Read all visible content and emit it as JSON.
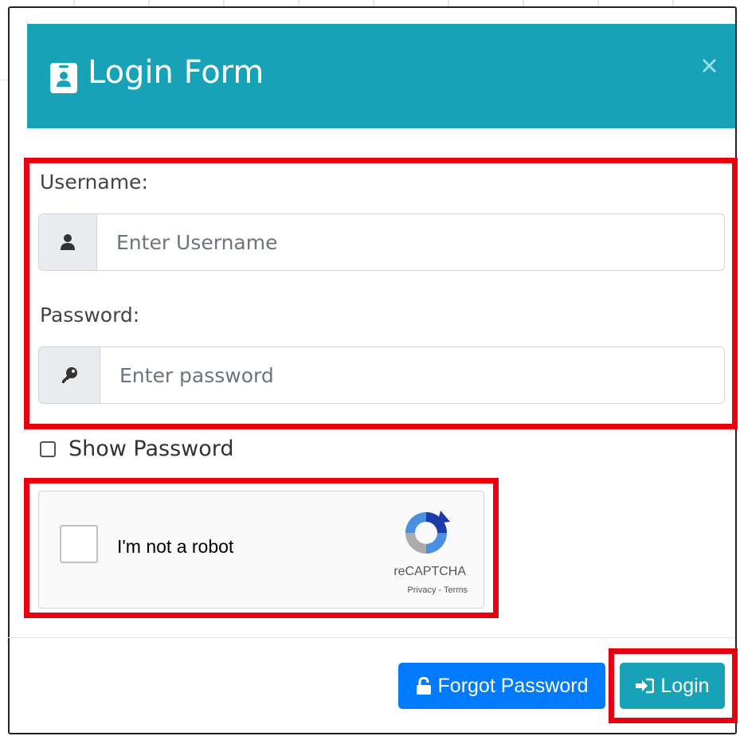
{
  "modal": {
    "title": "Login Form",
    "close_label": "×"
  },
  "form": {
    "username_label": "Username:",
    "username_placeholder": "Enter Username",
    "password_label": "Password:",
    "password_placeholder": "Enter password",
    "show_password_label": "Show Password"
  },
  "captcha": {
    "label": "I'm not a robot",
    "brand": "reCAPTCHA",
    "links": "Privacy - Terms"
  },
  "footer": {
    "forgot_label": "Forgot Password",
    "login_label": "Login"
  },
  "colors": {
    "header": "#18a2b8",
    "primary": "#007bff",
    "info": "#17a2b8",
    "highlight": "#e8000e"
  },
  "icons": {
    "title": "id-badge-icon",
    "username": "user-icon",
    "password": "key-icon",
    "forgot": "unlock-icon",
    "login": "sign-in-icon"
  }
}
